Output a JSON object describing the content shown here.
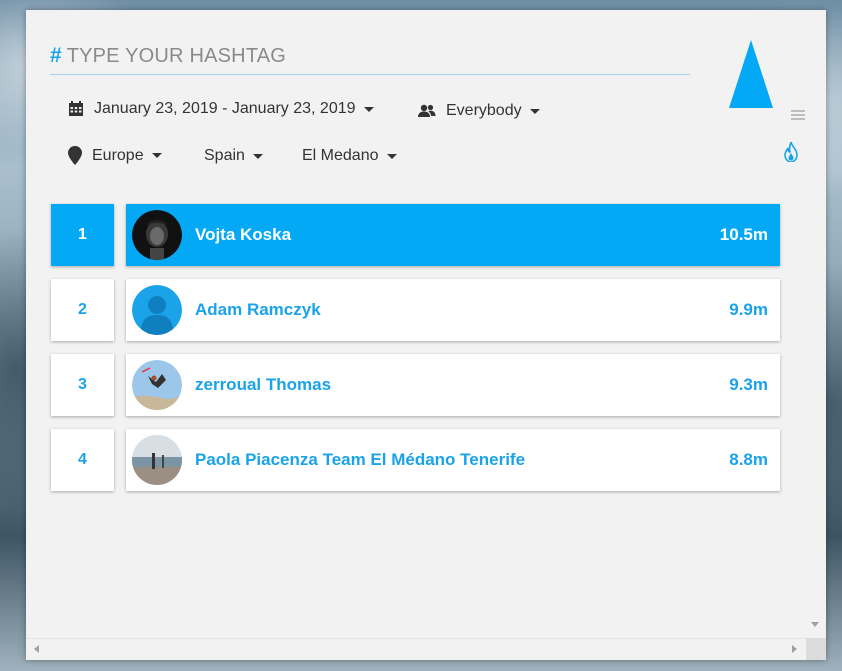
{
  "hashtag": {
    "symbol": "#",
    "placeholder": "TYPE YOUR HASHTAG"
  },
  "filters": {
    "date_range": "January 23, 2019 - January 23, 2019",
    "audience": "Everybody",
    "region": "Europe",
    "country": "Spain",
    "spot": "El Medano"
  },
  "leaderboard": [
    {
      "rank": "1",
      "name": "Vojta Koska",
      "score": "10.5m",
      "active": true
    },
    {
      "rank": "2",
      "name": "Adam Ramczyk",
      "score": "9.9m",
      "active": false
    },
    {
      "rank": "3",
      "name": "zerroual Thomas",
      "score": "9.3m",
      "active": false
    },
    {
      "rank": "4",
      "name": "Paola Piacenza Team El Médano Tenerife",
      "score": "8.8m",
      "active": false
    }
  ],
  "icons": {
    "calendar": "calendar-icon",
    "users": "users-icon",
    "location": "map-marker-icon",
    "menu": "menu-icon",
    "fire": "fire-icon",
    "logo": "triangle-logo"
  },
  "colors": {
    "accent": "#03a9f4",
    "panel": "#f2f2f2",
    "text": "#333333"
  }
}
